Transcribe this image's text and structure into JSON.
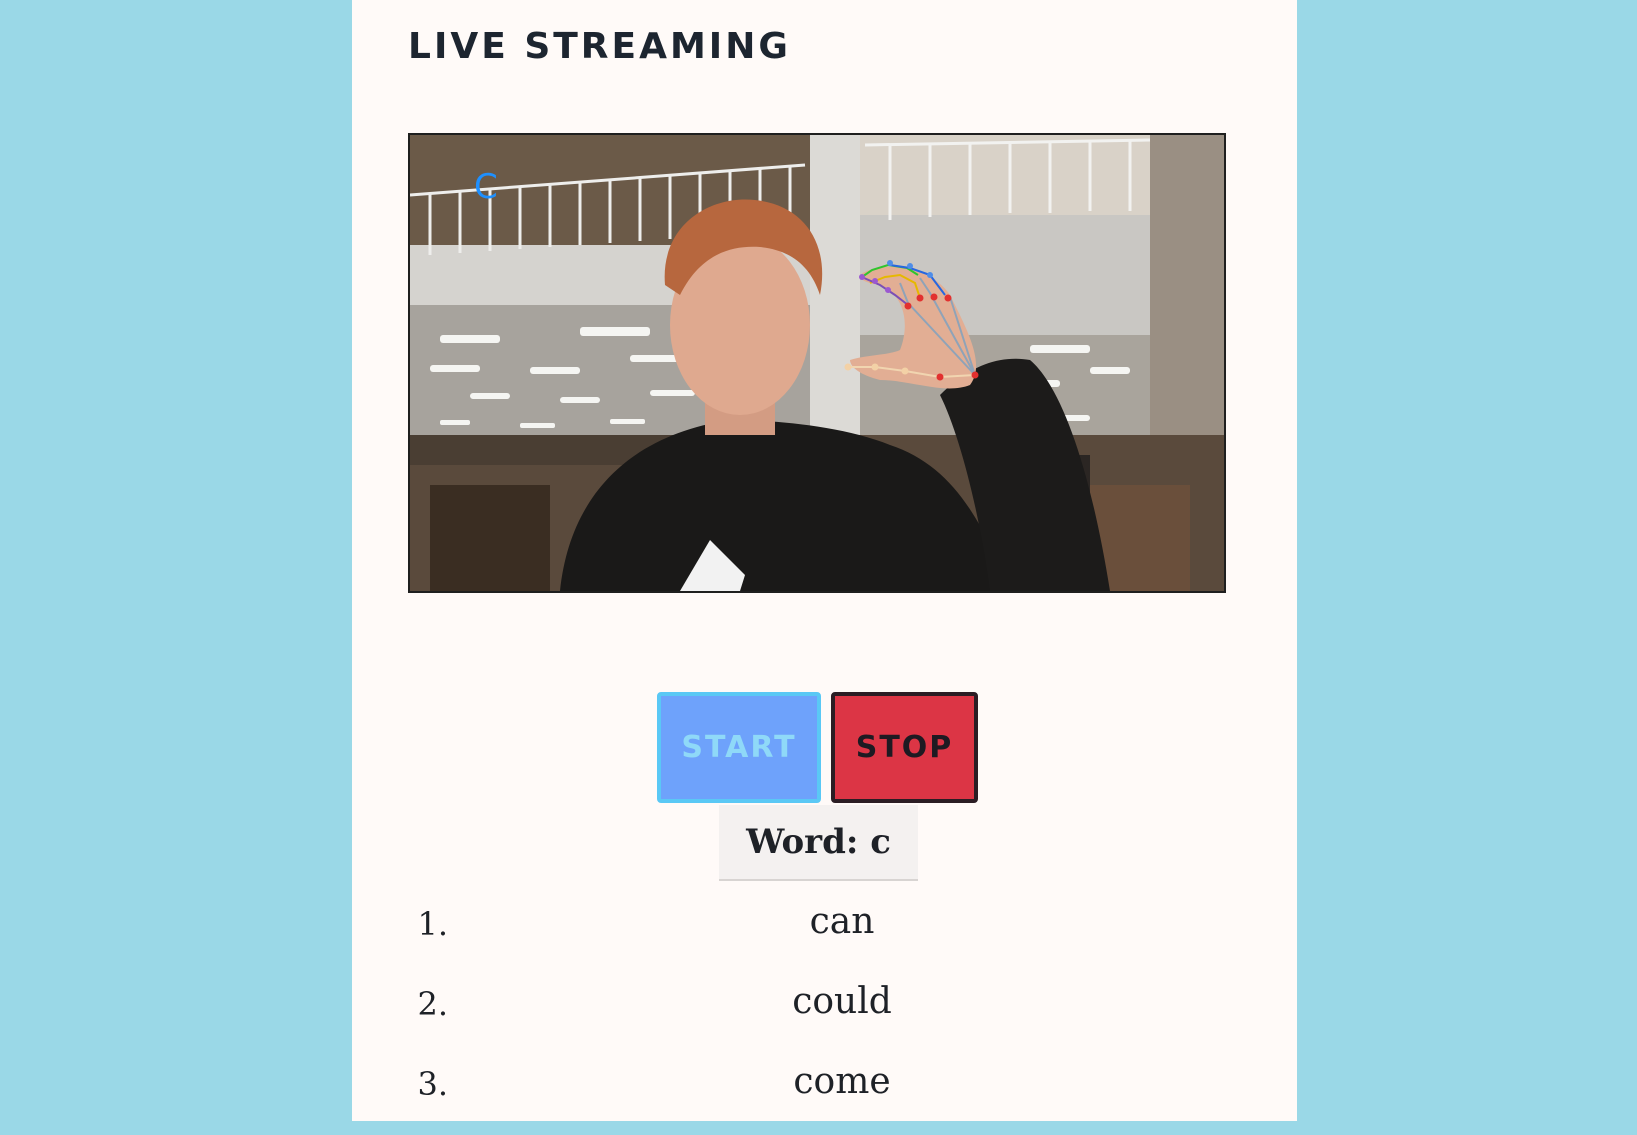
{
  "header": {
    "title": "LIVE STREAMING"
  },
  "video": {
    "detected_letter": "C",
    "overlay_color": "#1e90ff"
  },
  "controls": {
    "start_label": "START",
    "stop_label": "STOP",
    "start_color": "#6ea2fb",
    "stop_color": "#dc3545"
  },
  "word": {
    "text": "Word: c"
  },
  "suggestions": [
    {
      "num": "1.",
      "word": "can"
    },
    {
      "num": "2.",
      "word": "could"
    },
    {
      "num": "3.",
      "word": "come"
    }
  ]
}
